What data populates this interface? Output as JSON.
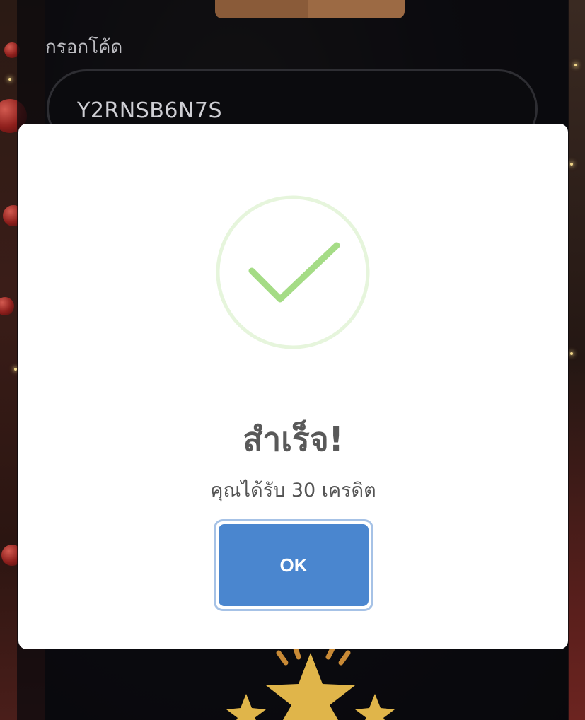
{
  "form": {
    "code_label": "กรอกโค้ด",
    "code_value": "Y2RNSB6N7S"
  },
  "modal": {
    "icon": "success-check-icon",
    "title": "สำเร็จ!",
    "message": "คุณได้รับ 30 เครดิต",
    "ok_label": "OK"
  },
  "colors": {
    "ok_button": "#4a86cf",
    "success_ring": "#e6f5dc",
    "success_check": "#a5dc86",
    "title_text": "#595959"
  }
}
